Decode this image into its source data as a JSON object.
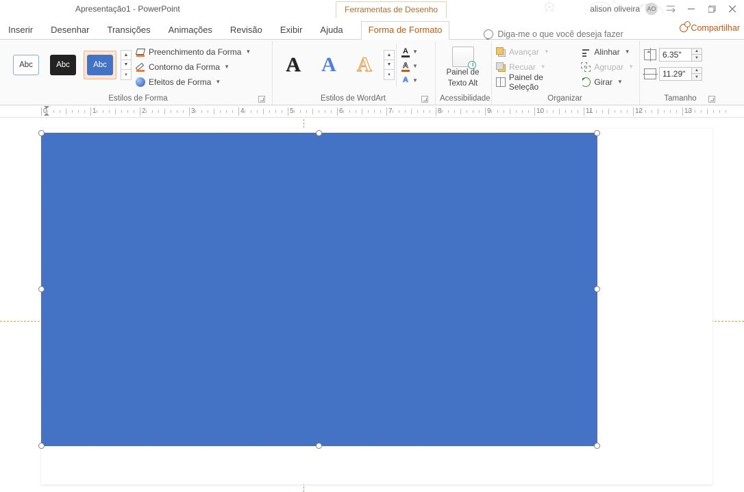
{
  "title_bar": {
    "doc_title": "Apresentação1 - PowerPoint",
    "contextual_tab": "Ferramentas de Desenho",
    "user_name": "alison oliveira",
    "user_initials": "AO"
  },
  "tabs": {
    "items": [
      "Inserir",
      "Desenhar",
      "Transições",
      "Animações",
      "Revisão",
      "Exibir",
      "Ajuda"
    ],
    "active": "Forma de Formato",
    "tell_me": "Diga-me o que você deseja fazer",
    "share": "Compartilhar"
  },
  "ribbon": {
    "shape_styles": {
      "thumb_label": "Abc",
      "fill": "Preenchimento da Forma",
      "outline": "Contorno da Forma",
      "effects": "Efeitos de Forma",
      "group_label": "Estilos de Forma"
    },
    "wordart": {
      "letter": "A",
      "group_label": "Estilos de WordArt"
    },
    "a11y": {
      "line1": "Painel de",
      "line2": "Texto Alt",
      "group_label": "Acessibilidade"
    },
    "organizer": {
      "bring_forward": "Avançar",
      "send_backward": "Recuar",
      "selection_pane": "Painel de Seleção",
      "align": "Alinhar",
      "group": "Agrupar",
      "rotate": "Girar",
      "group_label": "Organizar"
    },
    "size": {
      "height": "6.35\"",
      "width": "11.29\"",
      "group_label": "Tamanho"
    }
  },
  "ruler": {
    "nums": [
      "0",
      "1",
      "2",
      "3",
      "4",
      "5",
      "6",
      "7",
      "8",
      "9",
      "10",
      "11",
      "12",
      "13"
    ]
  }
}
